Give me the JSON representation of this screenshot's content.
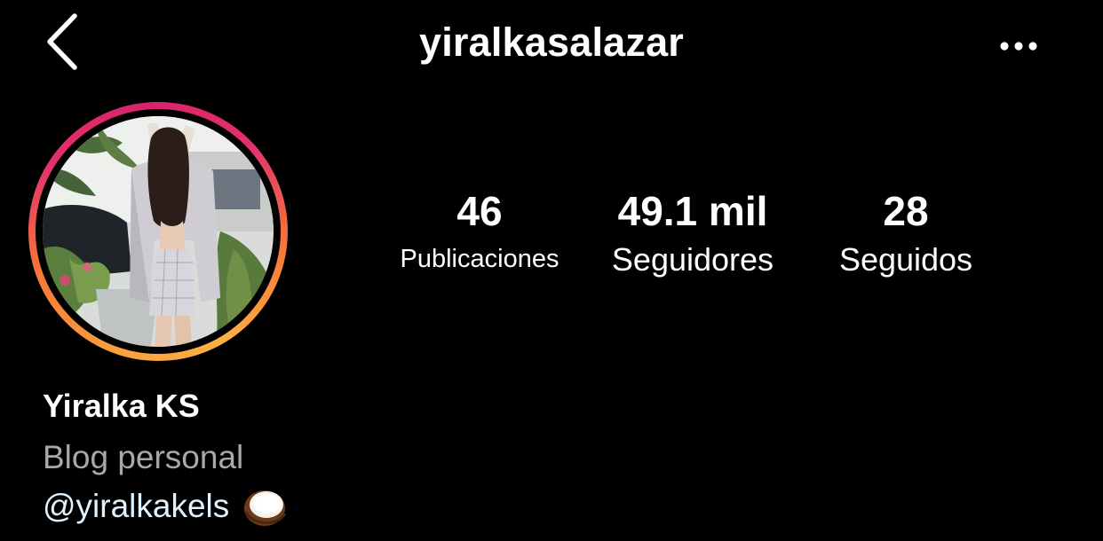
{
  "header": {
    "username": "yiralkasalazar",
    "back_icon": "chevron-left-icon",
    "more_icon": "more-horizontal-icon"
  },
  "profile": {
    "avatar_alt": "profile-photo",
    "story_ring_colors": [
      "#f9a03f",
      "#f77737",
      "#e1306c",
      "#fcb045"
    ]
  },
  "stats": {
    "posts": {
      "value": "46",
      "label": "Publicaciones"
    },
    "followers": {
      "value": "49.1 mil",
      "label": "Seguidores"
    },
    "following": {
      "value": "28",
      "label": "Seguidos"
    }
  },
  "bio": {
    "name": "Yiralka KS",
    "category": "Blog personal",
    "mention": "@yiralkakels",
    "mention_emoji_icon": "coconut-icon"
  },
  "colors": {
    "background": "#000000",
    "text": "#ffffff",
    "muted": "#a8a8a8",
    "link": "#e0f1ff"
  }
}
